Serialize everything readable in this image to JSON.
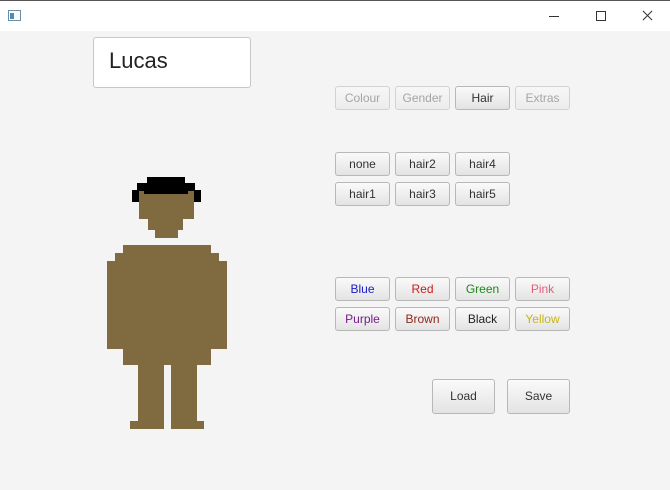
{
  "window": {
    "minimize": "minimize",
    "maximize": "maximize",
    "close": "close"
  },
  "character": {
    "name": "Lucas",
    "skin_color": "#806b40",
    "hair_color": "#000000"
  },
  "tabs": [
    {
      "label": "Colour",
      "enabled": false
    },
    {
      "label": "Gender",
      "enabled": false
    },
    {
      "label": "Hair",
      "enabled": true
    },
    {
      "label": "Extras",
      "enabled": false
    }
  ],
  "hair_options": [
    "none",
    "hair2",
    "hair4",
    "hair1",
    "hair3",
    "hair5"
  ],
  "colors": [
    {
      "label": "Blue",
      "color": "#1a1acc"
    },
    {
      "label": "Red",
      "color": "#cc1a1a"
    },
    {
      "label": "Green",
      "color": "#1a8a1a"
    },
    {
      "label": "Pink",
      "color": "#e0607a"
    },
    {
      "label": "Purple",
      "color": "#7a1a8a"
    },
    {
      "label": "Brown",
      "color": "#8a2a1a"
    },
    {
      "label": "Black",
      "color": "#222222"
    },
    {
      "label": "Yellow",
      "color": "#c8b41a"
    }
  ],
  "actions": {
    "load": "Load",
    "save": "Save"
  }
}
